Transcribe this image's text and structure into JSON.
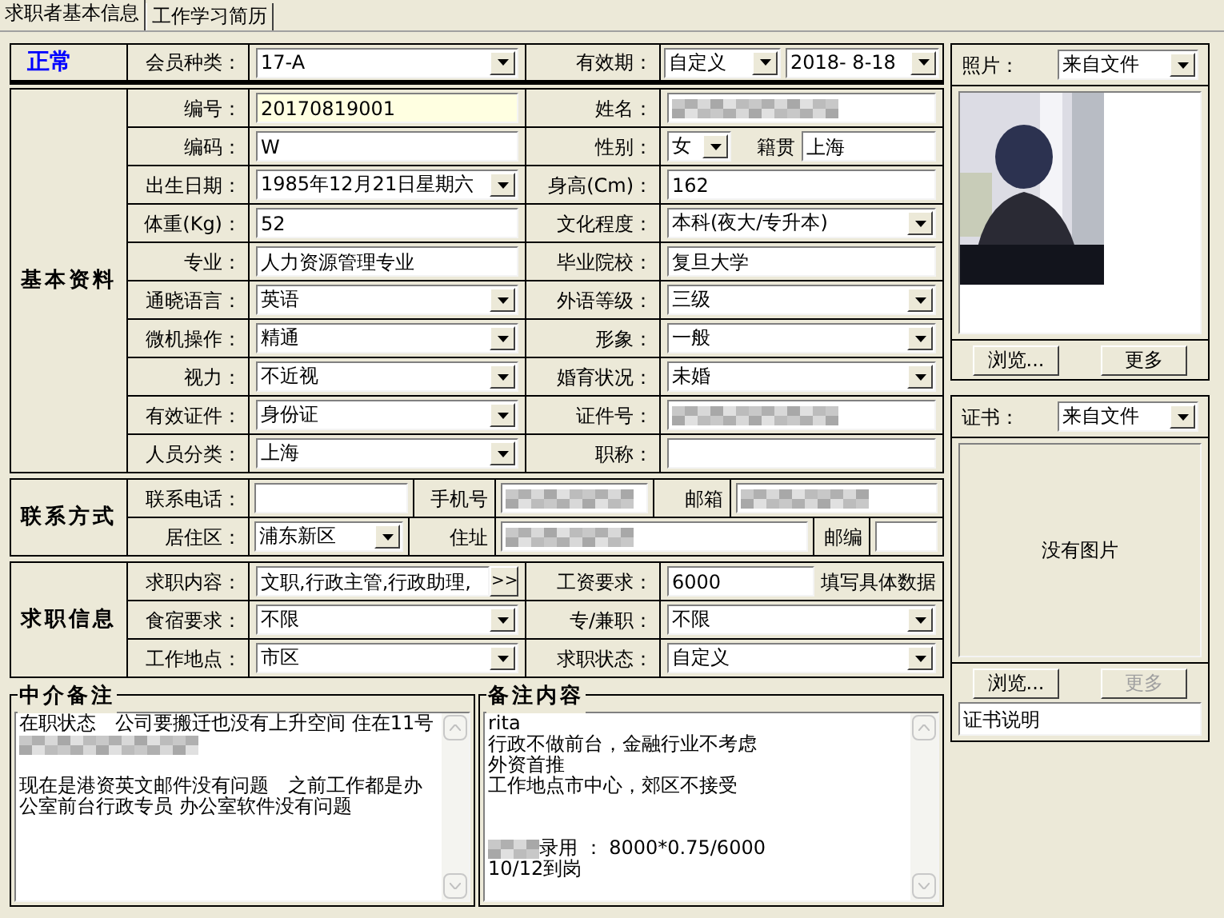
{
  "tabs": [
    {
      "label": "求职者基本信息",
      "selected": true
    },
    {
      "label": "工作学习简历",
      "selected": false
    }
  ],
  "status": "正常",
  "membership": {
    "label": "会员种类：",
    "value": "17-A"
  },
  "validity": {
    "label": "有效期：",
    "mode": "自定义",
    "date": "2018- 8-18"
  },
  "basic": {
    "title": "基本资料",
    "rows": [
      {
        "left": {
          "label": "编号：",
          "kind": "key",
          "value": "20170819001"
        },
        "right": {
          "label": "姓名：",
          "kind": "redacted"
        }
      },
      {
        "left": {
          "label": "编码：",
          "kind": "text",
          "value": "W"
        },
        "right": {
          "label": "性别：",
          "kind": "gender",
          "value": "女",
          "extra_label": "籍贯",
          "extra_value": "上海"
        }
      },
      {
        "left": {
          "label": "出生日期：",
          "kind": "combo",
          "value": "1985年12月21日星期六"
        },
        "right": {
          "label": "身高(Cm)：",
          "kind": "text",
          "value": "162"
        }
      },
      {
        "left": {
          "label": "体重(Kg)：",
          "kind": "text",
          "value": "52"
        },
        "right": {
          "label": "文化程度：",
          "kind": "combo",
          "value": "本科(夜大/专升本)"
        }
      },
      {
        "left": {
          "label": "专业：",
          "kind": "text",
          "value": "人力资源管理专业"
        },
        "right": {
          "label": "毕业院校：",
          "kind": "text",
          "value": "复旦大学"
        }
      },
      {
        "left": {
          "label": "通晓语言：",
          "kind": "combo",
          "value": "英语"
        },
        "right": {
          "label": "外语等级：",
          "kind": "combo",
          "value": "三级"
        }
      },
      {
        "left": {
          "label": "微机操作：",
          "kind": "combo",
          "value": "精通"
        },
        "right": {
          "label": "形象：",
          "kind": "combo",
          "value": "一般"
        }
      },
      {
        "left": {
          "label": "视力：",
          "kind": "combo",
          "value": "不近视"
        },
        "right": {
          "label": "婚育状况：",
          "kind": "combo",
          "value": "未婚"
        }
      },
      {
        "left": {
          "label": "有效证件：",
          "kind": "combo",
          "value": "身份证"
        },
        "right": {
          "label": "证件号：",
          "kind": "redacted"
        }
      },
      {
        "left": {
          "label": "人员分类：",
          "kind": "combo",
          "value": "上海"
        },
        "right": {
          "label": "职称：",
          "kind": "text"
        }
      }
    ]
  },
  "contact": {
    "title": "联系方式",
    "rows": [
      [
        {
          "kind": "label",
          "text": "联系电话："
        },
        {
          "kind": "text"
        },
        {
          "kind": "label",
          "text": "手机号"
        },
        {
          "kind": "redacted"
        },
        {
          "kind": "label",
          "text": "邮箱"
        },
        {
          "kind": "redacted"
        }
      ],
      [
        {
          "kind": "label",
          "text": "居住区："
        },
        {
          "kind": "combo",
          "value": "浦东新区"
        },
        {
          "kind": "label",
          "text": "住址"
        },
        {
          "kind": "redacted"
        },
        {
          "kind": "label",
          "text": "邮编"
        },
        {
          "kind": "text"
        }
      ]
    ]
  },
  "job": {
    "title": "求职信息",
    "rows": [
      {
        "left": {
          "label": "求职内容：",
          "kind": "more",
          "value": "文职,行政主管,行政助理,",
          "button": ">>"
        },
        "right": {
          "label": "工资要求：",
          "kind": "hint",
          "value": "6000",
          "hint": "填写具体数据"
        }
      },
      {
        "left": {
          "label": "食宿要求：",
          "kind": "combo",
          "value": "不限"
        },
        "right": {
          "label": "专/兼职：",
          "kind": "combo",
          "value": "不限"
        }
      },
      {
        "left": {
          "label": "工作地点：",
          "kind": "combo",
          "value": "市区"
        },
        "right": {
          "label": "求职状态：",
          "kind": "combo",
          "value": "自定义"
        }
      }
    ]
  },
  "notes": [
    {
      "title": "中介备注",
      "lines": [
        {
          "kind": "text",
          "text": "在职状态　公司要搬迁也没有上升空间 住在11号"
        },
        {
          "kind": "redacted"
        },
        {
          "kind": "blank"
        },
        {
          "kind": "text",
          "text": "现在是港资英文邮件没有问题　之前工作都是办"
        },
        {
          "kind": "text",
          "text": "公室前台行政专员 办公室软件没有问题"
        }
      ]
    },
    {
      "title": "备注内容",
      "lines": [
        {
          "kind": "text",
          "text": "rita"
        },
        {
          "kind": "text",
          "text": "行政不做前台，金融行业不考虑"
        },
        {
          "kind": "text",
          "text": "外资首推"
        },
        {
          "kind": "text",
          "text": "工作地点市中心，郊区不接受"
        },
        {
          "kind": "blank"
        },
        {
          "kind": "blank"
        },
        {
          "kind": "redacted_prefix",
          "text": "录用 ： 8000*0.75/6000"
        },
        {
          "kind": "text",
          "text": "10/12到岗"
        }
      ]
    }
  ],
  "photo": {
    "label": "照片：",
    "source": "来自文件",
    "buttons": [
      {
        "label": "浏览...",
        "disabled": false
      },
      {
        "label": "更多",
        "disabled": false
      }
    ]
  },
  "certificate": {
    "label": "证书：",
    "source": "来自文件",
    "empty_text": "没有图片",
    "buttons": [
      {
        "label": "浏览...",
        "disabled": false
      },
      {
        "label": "更多",
        "disabled": true
      }
    ],
    "caption": "证书说明"
  }
}
